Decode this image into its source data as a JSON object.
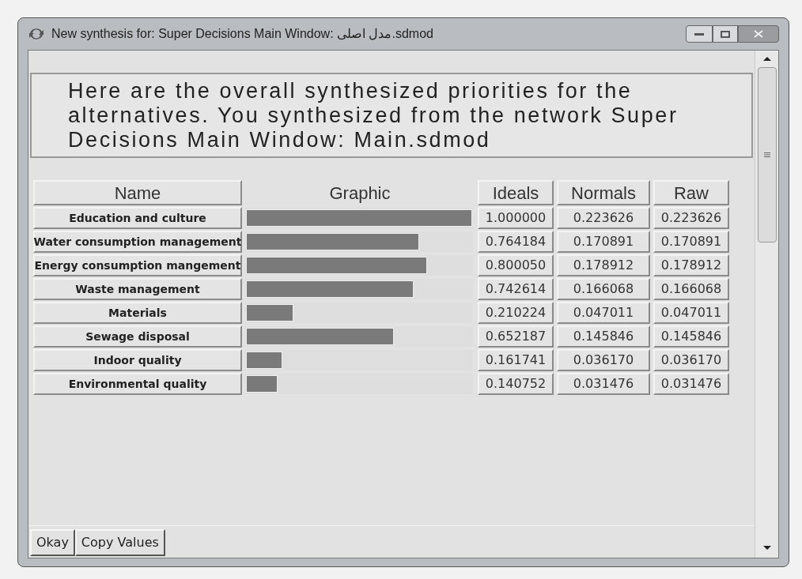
{
  "window": {
    "title": "New synthesis for: Super Decisions Main Window: مدل اصلی.sdmod"
  },
  "description": "Here are the overall synthesized priorities for the alternatives.  You synthesized from the network Super Decisions Main Window: Main.sdmod",
  "table": {
    "columns": [
      "Name",
      "Graphic",
      "Ideals",
      "Normals",
      "Raw"
    ],
    "rows": [
      {
        "name": "Education and culture",
        "level": 1.0,
        "ideals": "1.000000",
        "normals": "0.223626",
        "raw": "0.223626"
      },
      {
        "name": "Water consumption management",
        "level": 0.764184,
        "ideals": "0.764184",
        "normals": "0.170891",
        "raw": "0.170891"
      },
      {
        "name": "Energy consumption mangement",
        "level": 0.80005,
        "ideals": "0.800050",
        "normals": "0.178912",
        "raw": "0.178912"
      },
      {
        "name": "Waste management",
        "level": 0.742614,
        "ideals": "0.742614",
        "normals": "0.166068",
        "raw": "0.166068"
      },
      {
        "name": "Materials",
        "level": 0.210224,
        "ideals": "0.210224",
        "normals": "0.047011",
        "raw": "0.047011"
      },
      {
        "name": "Sewage disposal",
        "level": 0.652187,
        "ideals": "0.652187",
        "normals": "0.145846",
        "raw": "0.145846"
      },
      {
        "name": "Indoor quality",
        "level": 0.161741,
        "ideals": "0.161741",
        "normals": "0.036170",
        "raw": "0.036170"
      },
      {
        "name": "Environmental quality",
        "level": 0.140752,
        "ideals": "0.140752",
        "normals": "0.031476",
        "raw": "0.031476"
      }
    ]
  },
  "buttons": [
    "Okay",
    "Copy Values"
  ]
}
